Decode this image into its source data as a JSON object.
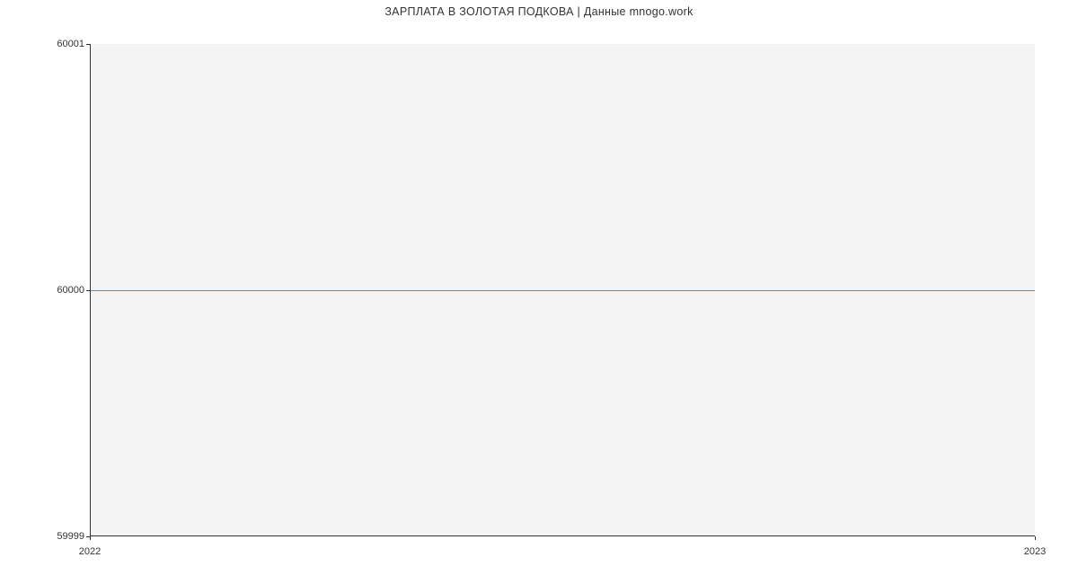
{
  "chart_data": {
    "type": "line",
    "title": "ЗАРПЛАТА В  ЗОЛОТАЯ ПОДКОВА | Данные mnogo.work",
    "xlabel": "",
    "ylabel": "",
    "x": [
      "2022",
      "2023"
    ],
    "y": [
      60000,
      60000
    ],
    "xlim": [
      "2022",
      "2023"
    ],
    "ylim": [
      59999,
      60001
    ],
    "y_ticks": [
      59999,
      60000,
      60001
    ],
    "x_ticks": [
      "2022",
      "2023"
    ]
  },
  "y_labels": {
    "top": "60001",
    "mid": "60000",
    "bot": "59999"
  },
  "x_labels": {
    "left": "2022",
    "right": "2023"
  }
}
